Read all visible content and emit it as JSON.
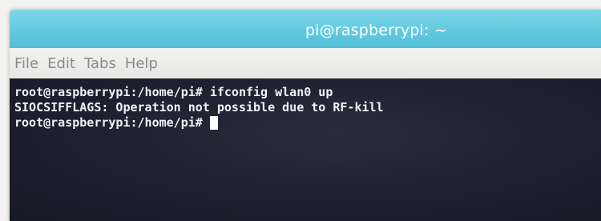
{
  "window": {
    "title": "pi@raspberrypi: ~"
  },
  "menu": {
    "items": [
      "File",
      "Edit",
      "Tabs",
      "Help"
    ]
  },
  "terminal": {
    "lines": [
      "root@raspberrypi:/home/pi# ifconfig wlan0 up",
      "SIOCSIFFLAGS: Operation not possible due to RF-kill"
    ],
    "prompt": "root@raspberrypi:/home/pi#"
  },
  "colors": {
    "titlebar": "#60c8df",
    "terminal_bg": "#1e2030",
    "terminal_fg": "#f2f2f4",
    "menu_text": "#8a8a8a"
  }
}
